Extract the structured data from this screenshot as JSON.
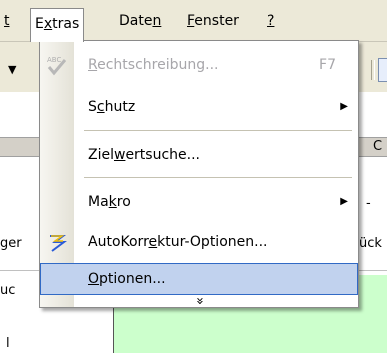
{
  "menubar": {
    "items": [
      {
        "label_pre": "",
        "label_u": "t",
        "label_post": "",
        "text": "at"
      },
      {
        "label_pre": "E",
        "label_u": "x",
        "label_post": "tras"
      },
      {
        "label_pre": "Date",
        "label_u": "n",
        "label_post": ""
      },
      {
        "label_pre": "",
        "label_u": "F",
        "label_post": "enster"
      },
      {
        "label_pre": "",
        "label_u": "?",
        "label_post": ""
      }
    ]
  },
  "menu": {
    "items": [
      {
        "pre": "",
        "u": "R",
        "post": "echtschreibung...",
        "shortcut": "F7",
        "icon": "spellcheck-icon",
        "disabled": true
      },
      {
        "pre": "S",
        "u": "c",
        "post": "hutz",
        "submenu": true
      },
      {
        "pre": "Ziel",
        "u": "w",
        "post": "ertsuche..."
      },
      {
        "pre": "Ma",
        "u": "k",
        "post": "ro",
        "submenu": true
      },
      {
        "pre": "AutoKorr",
        "u": "e",
        "post": "ktur-Optionen...",
        "icon": "autocorrect-icon"
      },
      {
        "pre": "",
        "u": "O",
        "post": "ptionen...",
        "hover": true
      }
    ],
    "expand_glyph": "»"
  },
  "sheet": {
    "col_c": "C",
    "left_text_1": "ger",
    "left_text_2": "uc",
    "left_text_3": "l",
    "right_text": "ück",
    "dash": "-"
  },
  "colors": {
    "menubar_bg": "#ece9d8",
    "hover_bg": "#c1d2ee",
    "hover_border": "#316ac5",
    "cell_green": "#ccffcc"
  }
}
